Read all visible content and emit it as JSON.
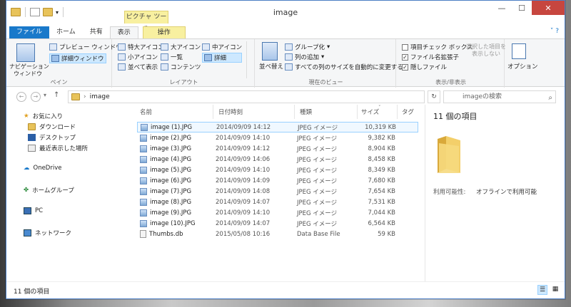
{
  "window": {
    "title": "image",
    "contextual_group": "ピクチャ ツール"
  },
  "tabs": [
    "ファイル",
    "ホーム",
    "共有",
    "表示",
    "操作"
  ],
  "ribbon": {
    "pane": {
      "nav_pane_label": "ナビゲーション\nウィンドウ",
      "preview_label": "プレビュー ウィンドウ",
      "details_label": "詳細ウィンドウ",
      "group_label": "ペイン"
    },
    "layout": {
      "items": [
        "特大アイコン",
        "大アイコン",
        "中アイコン",
        "小アイコン",
        "一覧",
        "詳細",
        "並べて表示",
        "コンテンツ"
      ],
      "group_label": "レイアウト"
    },
    "current_view": {
      "sort_label": "並べ替え",
      "group_by": "グループ化",
      "add_column": "列の追加",
      "fit_columns": "すべての列のサイズを自動的に変更する",
      "group_label": "現在のビュー"
    },
    "show_hide": {
      "item_checkbox": "項目チェック ボックス",
      "file_ext": "ファイル名拡張子",
      "hidden_files": "隠しファイル",
      "hide_selected": "選択した項目を\n表示しない",
      "group_label": "表示/非表示"
    },
    "options_label": "オプション"
  },
  "address": {
    "path": "image",
    "search_placeholder": "imageの検索"
  },
  "navpane": {
    "favorites": "お気に入り",
    "downloads": "ダウンロード",
    "desktop": "デスクトップ",
    "recent": "最近表示した場所",
    "onedrive": "OneDrive",
    "homegroup": "ホームグループ",
    "pc": "PC",
    "network": "ネットワーク"
  },
  "columns": {
    "name": "名前",
    "date": "日付時刻",
    "type": "種類",
    "size": "サイズ",
    "tag": "タグ"
  },
  "files": [
    {
      "name": "image (1).JPG",
      "date": "2014/09/09 14:12",
      "type": "JPEG イメージ",
      "size": "10,319 KB"
    },
    {
      "name": "image (2).JPG",
      "date": "2014/09/09 14:10",
      "type": "JPEG イメージ",
      "size": "9,382 KB"
    },
    {
      "name": "image (3).JPG",
      "date": "2014/09/09 14:12",
      "type": "JPEG イメージ",
      "size": "8,904 KB"
    },
    {
      "name": "image (4).JPG",
      "date": "2014/09/09 14:06",
      "type": "JPEG イメージ",
      "size": "8,458 KB"
    },
    {
      "name": "image (5).JPG",
      "date": "2014/09/09 14:10",
      "type": "JPEG イメージ",
      "size": "8,349 KB"
    },
    {
      "name": "image (6).JPG",
      "date": "2014/09/09 14:09",
      "type": "JPEG イメージ",
      "size": "7,680 KB"
    },
    {
      "name": "image (7).JPG",
      "date": "2014/09/09 14:08",
      "type": "JPEG イメージ",
      "size": "7,654 KB"
    },
    {
      "name": "image (8).JPG",
      "date": "2014/09/09 14:07",
      "type": "JPEG イメージ",
      "size": "7,531 KB"
    },
    {
      "name": "image (9).JPG",
      "date": "2014/09/09 14:10",
      "type": "JPEG イメージ",
      "size": "7,044 KB"
    },
    {
      "name": "image (10).JPG",
      "date": "2014/09/09 14:07",
      "type": "JPEG イメージ",
      "size": "6,564 KB"
    },
    {
      "name": "Thumbs.db",
      "date": "2015/05/08 10:16",
      "type": "Data Base File",
      "size": "59 KB"
    }
  ],
  "details": {
    "count": "11 個の項目",
    "availability_label": "利用可能性:",
    "availability_value": "オフラインで利用可能"
  },
  "status": {
    "count": "11 個の項目"
  }
}
